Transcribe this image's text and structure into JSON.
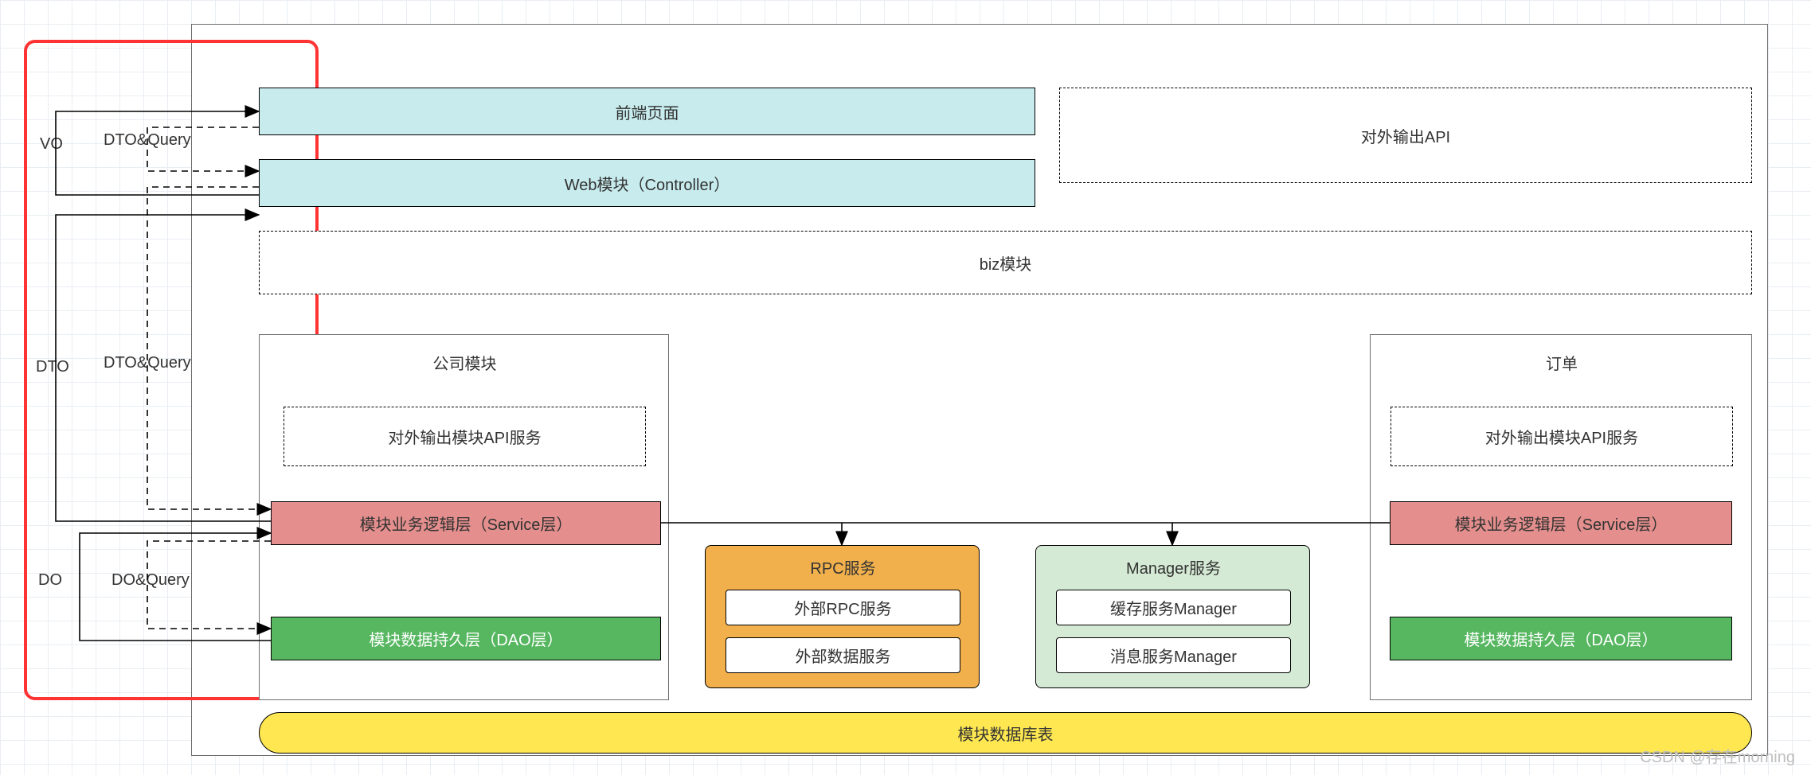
{
  "labels": {
    "vo": "VO",
    "dto": "DTO",
    "do": "DO",
    "dtoQuery1": "DTO&Query",
    "dtoQuery2": "DTO&Query",
    "doQuery": "DO&Query"
  },
  "boxes": {
    "frontend": "前端页面",
    "apiOut": "对外输出API",
    "controller": "Web模块（Controller）",
    "biz": "biz模块",
    "moduleCompany": "公司模块",
    "moduleOrder": "订单",
    "apiSvcCompany": "对外输出模块API服务",
    "apiSvcOrder": "对外输出模块API服务",
    "serviceCompany": "模块业务逻辑层（Service层）",
    "serviceOrder": "模块业务逻辑层（Service层）",
    "daoCompany": "模块数据持久层（DAO层）",
    "daoOrder": "模块数据持久层（DAO层）",
    "rpcTitle": "RPC服务",
    "rpcItem1": "外部RPC服务",
    "rpcItem2": "外部数据服务",
    "mgrTitle": "Manager服务",
    "mgrItem1": "缓存服务Manager",
    "mgrItem2": "消息服务Manager",
    "db": "模块数据库表"
  },
  "watermark": "CSDN @存在morning"
}
